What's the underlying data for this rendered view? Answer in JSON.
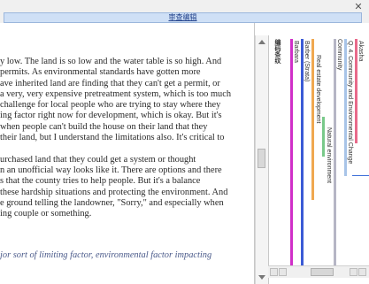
{
  "window": {
    "tab_label": "审查编辑"
  },
  "document": {
    "lines": [
      "y low. The land is so low and the water table is so high. And",
      "permits. As environmental standards have gotten more",
      "ave inherited land are finding that they can't get a permit, or",
      "a very, very expensive pretreatment system, which is too much",
      "challenge for local people who are trying to stay where they",
      "ing factor right now for development, which is okay. But it's",
      "when people can't build the house on their land that they",
      "their land, but I understand the limitations also. It's critical to",
      "",
      "urchased land that they could get a system or thought",
      "n an unofficial way looks like it. There are options and there",
      "s that the county tries to help people. But it's a balance",
      "these hardship situations and protecting the environment. And",
      "e ground telling the landowner, \"Sorry,\" and especially when",
      "ing couple or something."
    ],
    "footer_text": "jor sort of limiting factor, environmental factor impacting"
  },
  "coding": {
    "labels": [
      "编码条纹",
      "Barbara",
      "Barber (Strata)",
      "Real estate development",
      "Natural environment",
      "Community",
      "Q. 4. Community and Environmental Change",
      "Akasha"
    ],
    "colors": {
      "magenta": "#d02fc8",
      "blue": "#3b5bd6",
      "orange": "#f0a850",
      "pink": "#e86a8a",
      "green": "#79c98a",
      "gray": "#b5b5c5",
      "lightblue": "#a8c4e8"
    }
  }
}
